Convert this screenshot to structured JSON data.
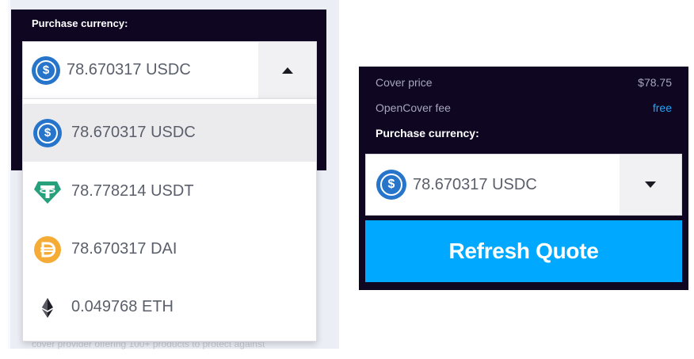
{
  "left": {
    "currency_label": "Purchase currency:",
    "selected_amount": "78.670317 USDC",
    "options": [
      {
        "amount": "78.670317 USDC",
        "icon": "usdc-icon"
      },
      {
        "amount": "78.778214 USDT",
        "icon": "usdt-icon"
      },
      {
        "amount": "78.670317 DAI",
        "icon": "dai-icon"
      },
      {
        "amount": "0.049768 ETH",
        "icon": "eth-icon"
      }
    ],
    "partial_text_behind": "cover provider offering 100+ products to protect against"
  },
  "right": {
    "cover_price_label": "Cover price",
    "cover_price_value": "$78.75",
    "fee_label": "OpenCover fee",
    "fee_value": "free",
    "currency_label": "Purchase currency:",
    "selected_amount": "78.670317 USDC",
    "refresh_label": "Refresh Quote"
  },
  "colors": {
    "dark_bg": "#0f0722",
    "accent_blue": "#00a8ff",
    "fee_free": "#1ea7ff",
    "usdc": "#2775ca",
    "usdt": "#26a17b",
    "dai": "#f5ac37"
  }
}
